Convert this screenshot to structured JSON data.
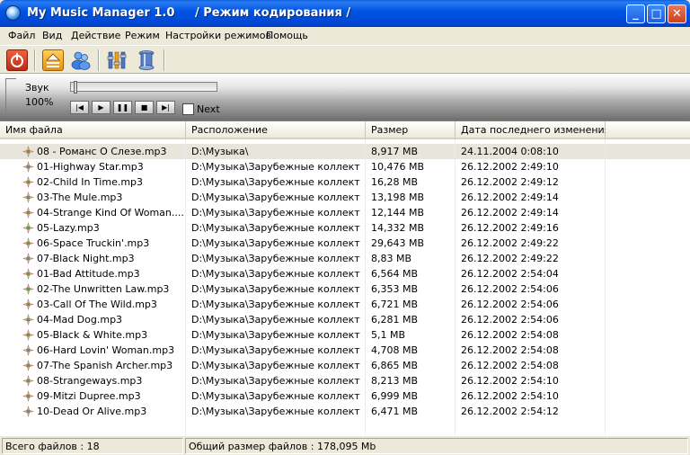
{
  "window": {
    "title": "My Music Manager 1.0     / Режим кодирования /",
    "minimize": "_",
    "maximize": "□",
    "close": "✕"
  },
  "menu": [
    "Файл",
    "Вид",
    "Действие",
    "Режим",
    "Настройки режимов",
    "Помощь"
  ],
  "toolbar": {
    "icons": [
      "power-icon",
      "eject-icon",
      "people-icon",
      "settings-icon",
      "spool-icon"
    ]
  },
  "player": {
    "volume_label": "Звук",
    "volume_value": "100%",
    "next_label": "Next",
    "next_checked": false,
    "seek_position": 0
  },
  "columns": [
    "Имя файла",
    "Расположение",
    "Размер",
    "Дата последнего изменения"
  ],
  "rows": [
    {
      "name": "08 - Романс О Слезе.mp3",
      "path": "D:\\Музыка\\",
      "size": "8,917 MB",
      "date": "24.11.2004 0:08:10"
    },
    {
      "name": "01-Highway Star.mp3",
      "path": "D:\\Музыка\\Зарубежные коллект...",
      "size": "10,476 MB",
      "date": "26.12.2002 2:49:10"
    },
    {
      "name": "02-Child In Time.mp3",
      "path": "D:\\Музыка\\Зарубежные коллект...",
      "size": "16,28 MB",
      "date": "26.12.2002 2:49:12"
    },
    {
      "name": "03-The Mule.mp3",
      "path": "D:\\Музыка\\Зарубежные коллект...",
      "size": "13,198 MB",
      "date": "26.12.2002 2:49:14"
    },
    {
      "name": "04-Strange Kind Of Woman....",
      "path": "D:\\Музыка\\Зарубежные коллект...",
      "size": "12,144 MB",
      "date": "26.12.2002 2:49:14"
    },
    {
      "name": "05-Lazy.mp3",
      "path": "D:\\Музыка\\Зарубежные коллект...",
      "size": "14,332 MB",
      "date": "26.12.2002 2:49:16"
    },
    {
      "name": "06-Space Truckin'.mp3",
      "path": "D:\\Музыка\\Зарубежные коллект...",
      "size": "29,643 MB",
      "date": "26.12.2002 2:49:22"
    },
    {
      "name": "07-Black Night.mp3",
      "path": "D:\\Музыка\\Зарубежные коллект...",
      "size": "8,83 MB",
      "date": "26.12.2002 2:49:22"
    },
    {
      "name": "01-Bad Attitude.mp3",
      "path": "D:\\Музыка\\Зарубежные коллект...",
      "size": "6,564 MB",
      "date": "26.12.2002 2:54:04"
    },
    {
      "name": "02-The Unwritten Law.mp3",
      "path": "D:\\Музыка\\Зарубежные коллект...",
      "size": "6,353 MB",
      "date": "26.12.2002 2:54:06"
    },
    {
      "name": "03-Call Of The Wild.mp3",
      "path": "D:\\Музыка\\Зарубежные коллект...",
      "size": "6,721 MB",
      "date": "26.12.2002 2:54:06"
    },
    {
      "name": "04-Mad Dog.mp3",
      "path": "D:\\Музыка\\Зарубежные коллект...",
      "size": "6,281 MB",
      "date": "26.12.2002 2:54:06"
    },
    {
      "name": "05-Black & White.mp3",
      "path": "D:\\Музыка\\Зарубежные коллект...",
      "size": "5,1 MB",
      "date": "26.12.2002 2:54:08"
    },
    {
      "name": "06-Hard Lovin' Woman.mp3",
      "path": "D:\\Музыка\\Зарубежные коллект...",
      "size": "4,708 MB",
      "date": "26.12.2002 2:54:08"
    },
    {
      "name": "07-The Spanish Archer.mp3",
      "path": "D:\\Музыка\\Зарубежные коллект...",
      "size": "6,865 MB",
      "date": "26.12.2002 2:54:08"
    },
    {
      "name": "08-Strangeways.mp3",
      "path": "D:\\Музыка\\Зарубежные коллект...",
      "size": "8,213 MB",
      "date": "26.12.2002 2:54:10"
    },
    {
      "name": "09-Mitzi Dupree.mp3",
      "path": "D:\\Музыка\\Зарубежные коллект...",
      "size": "6,999 MB",
      "date": "26.12.2002 2:54:10"
    },
    {
      "name": "10-Dead Or Alive.mp3",
      "path": "D:\\Музыка\\Зарубежные коллект...",
      "size": "6,471 MB",
      "date": "26.12.2002 2:54:12"
    }
  ],
  "selected_row": 0,
  "status": {
    "file_count": "Всего файлов : 18",
    "total_size": "Общий размер файлов : 178,095 Mb"
  },
  "colors": {
    "titlebar": "#0055e5",
    "selection": "#e8e6dc",
    "chrome": "#ece9d8"
  }
}
